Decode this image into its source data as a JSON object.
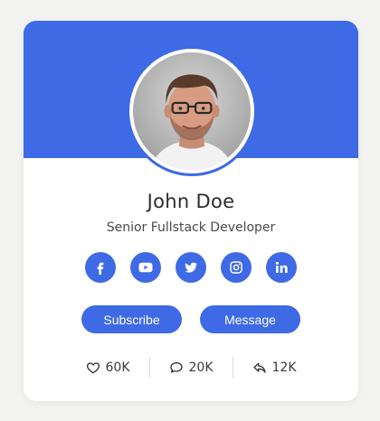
{
  "theme": {
    "accent": "#3f6ae5",
    "page_background": "#f3f3f1",
    "card_background": "#ffffff"
  },
  "profile": {
    "name": "John Doe",
    "role": "Senior Fullstack Developer",
    "avatar_icon": "user-photo"
  },
  "social_links": [
    {
      "network": "facebook",
      "icon": "facebook-icon"
    },
    {
      "network": "youtube",
      "icon": "youtube-icon"
    },
    {
      "network": "twitter",
      "icon": "twitter-icon"
    },
    {
      "network": "instagram",
      "icon": "instagram-icon"
    },
    {
      "network": "linkedin",
      "icon": "linkedin-icon"
    }
  ],
  "actions": {
    "subscribe_label": "Subscribe",
    "message_label": "Message"
  },
  "stats": [
    {
      "icon": "heart-icon",
      "value": "60K"
    },
    {
      "icon": "comment-icon",
      "value": "20K"
    },
    {
      "icon": "share-icon",
      "value": "12K"
    }
  ]
}
